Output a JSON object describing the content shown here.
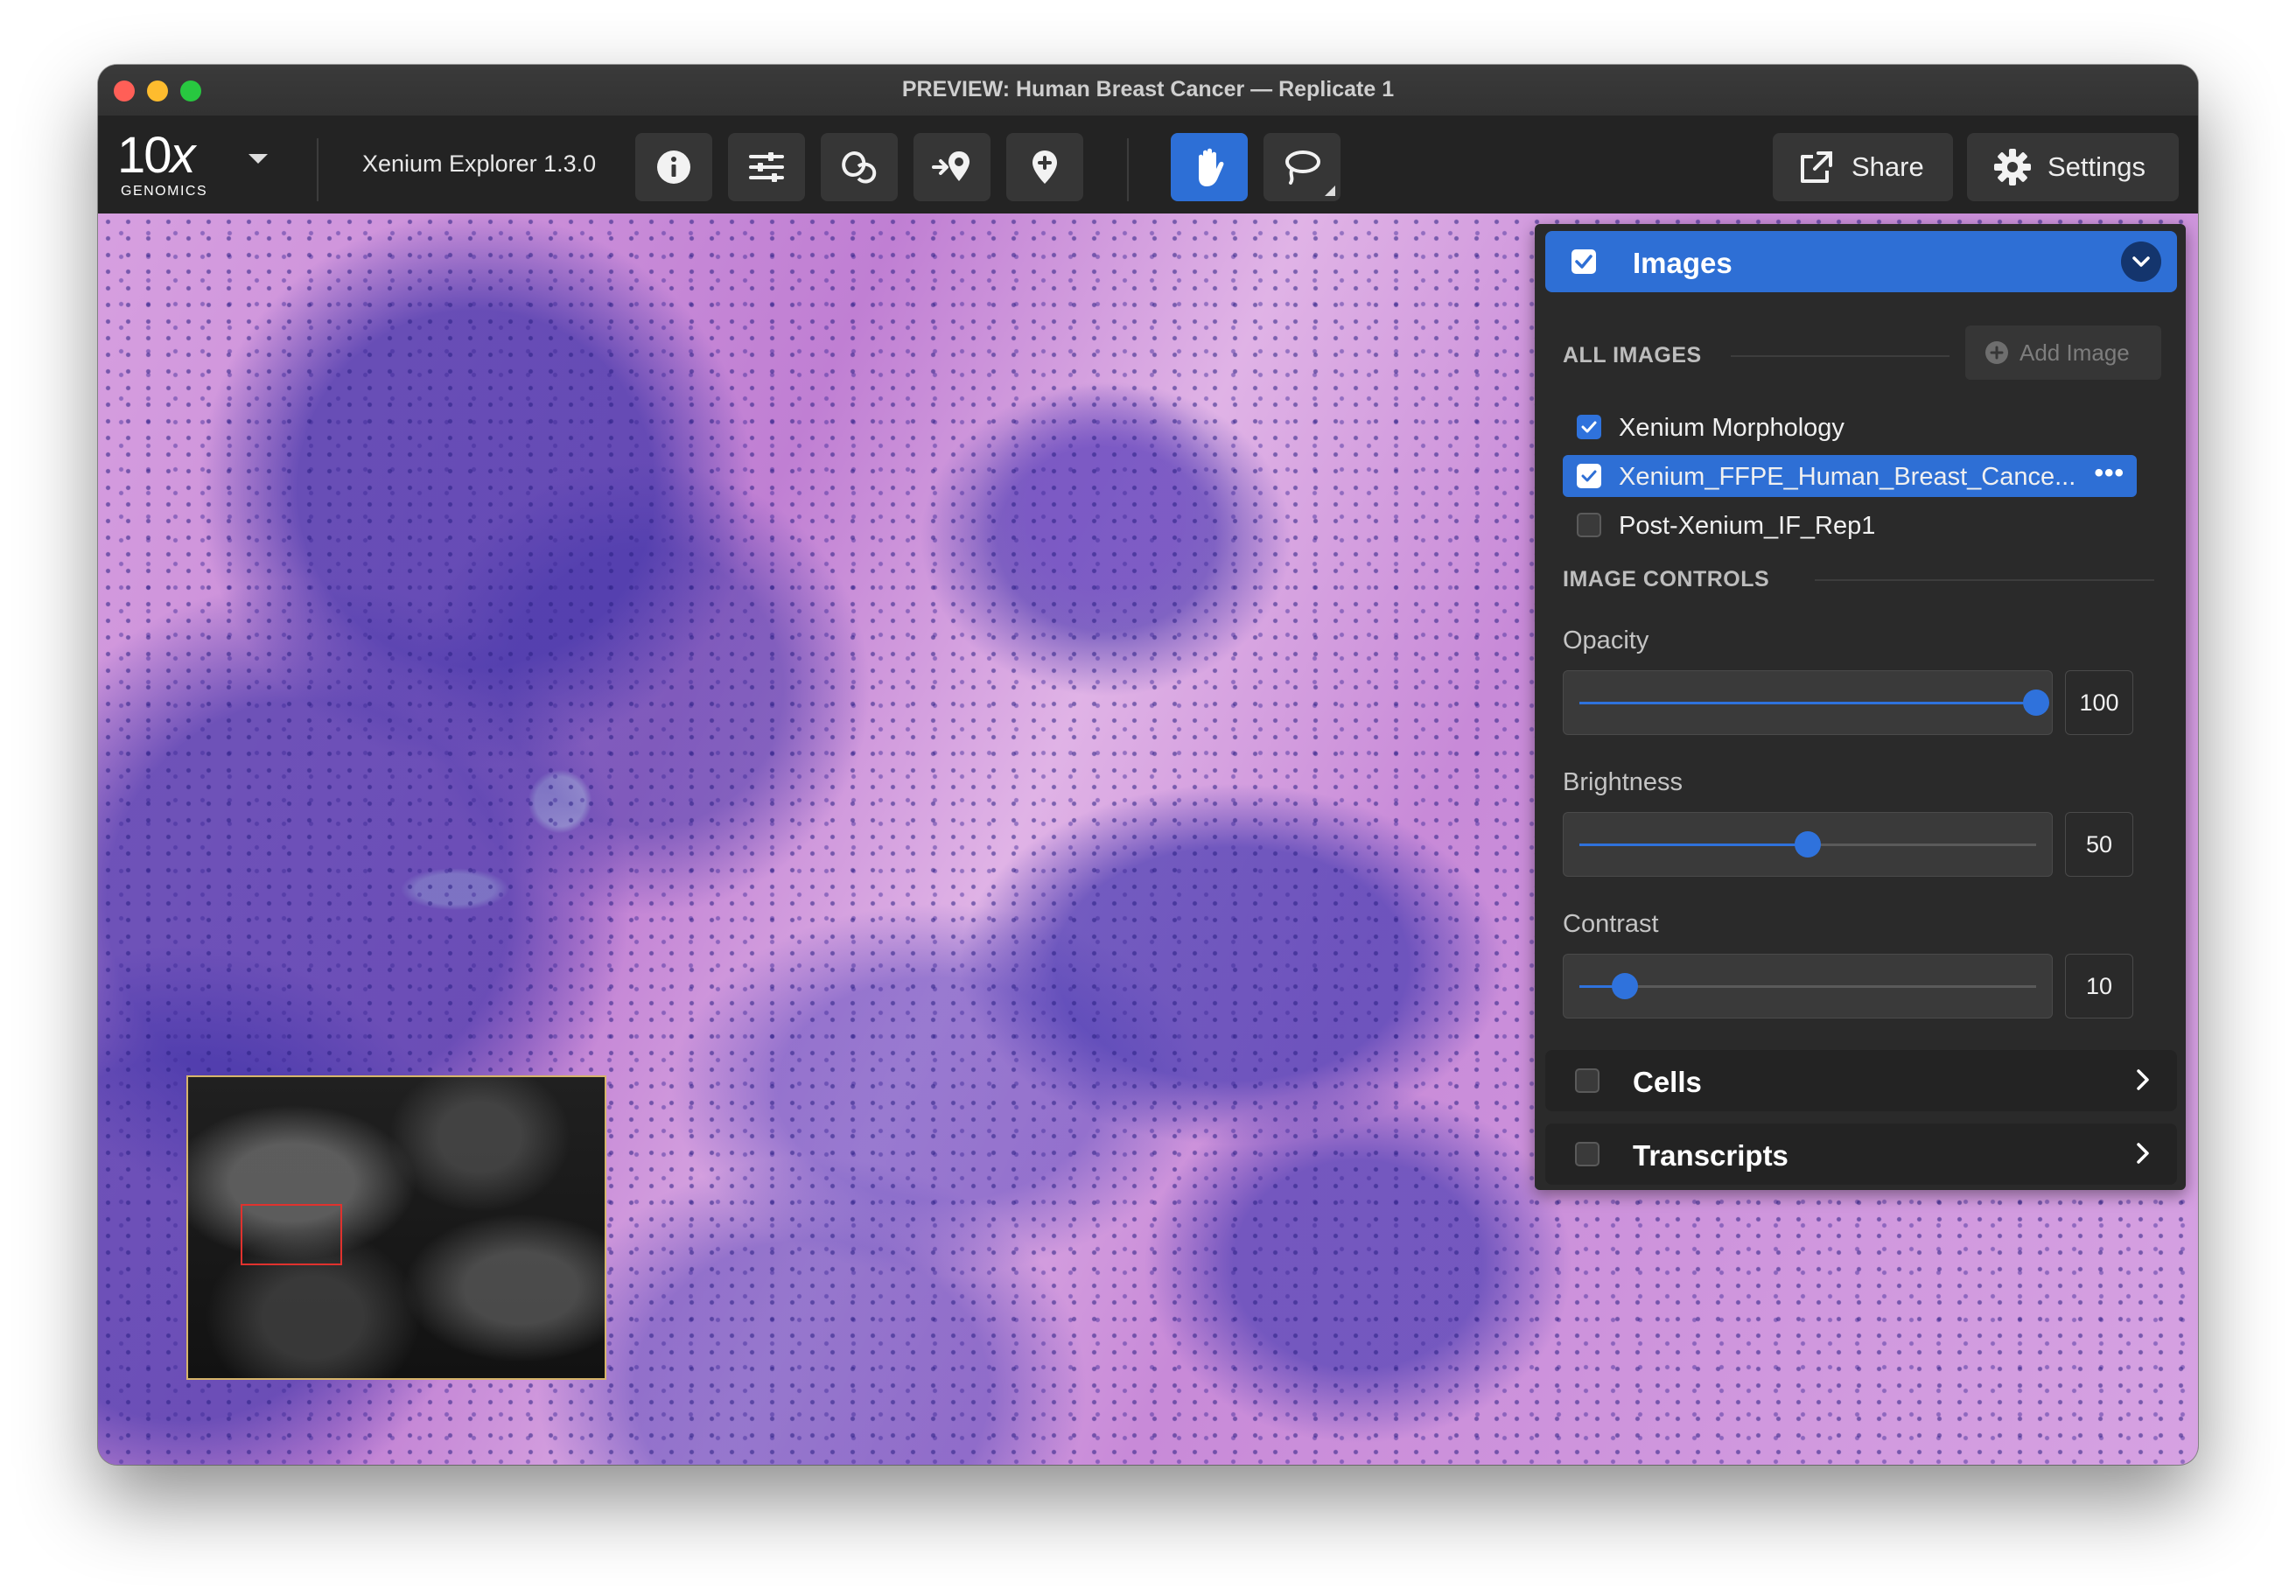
{
  "window": {
    "title": "PREVIEW: Human Breast Cancer — Replicate 1"
  },
  "toolbar": {
    "logo_main": "10",
    "logo_x": "x",
    "logo_sub": "GENOMICS",
    "app_version": "Xenium Explorer 1.3.0",
    "share_label": "Share",
    "settings_label": "Settings"
  },
  "panel": {
    "images_header": "Images",
    "all_images_label": "ALL IMAGES",
    "add_image_label": "Add Image",
    "images": [
      {
        "name": "Xenium Morphology",
        "checked": true,
        "selected": false
      },
      {
        "name": "Xenium_FFPE_Human_Breast_Cance...",
        "checked": true,
        "selected": true
      },
      {
        "name": "Post-Xenium_IF_Rep1",
        "checked": false,
        "selected": false
      }
    ],
    "image_controls_label": "IMAGE CONTROLS",
    "controls": {
      "opacity": {
        "label": "Opacity",
        "value": "100",
        "fraction": 1.0
      },
      "brightness": {
        "label": "Brightness",
        "value": "50",
        "fraction": 0.5
      },
      "contrast": {
        "label": "Contrast",
        "value": "10",
        "fraction": 0.1
      }
    },
    "cells_header": "Cells",
    "transcripts_header": "Transcripts"
  },
  "colors": {
    "accent": "#2e6fd5",
    "panel_bg": "#2a2a2a",
    "toolbar_bg": "#232323"
  }
}
